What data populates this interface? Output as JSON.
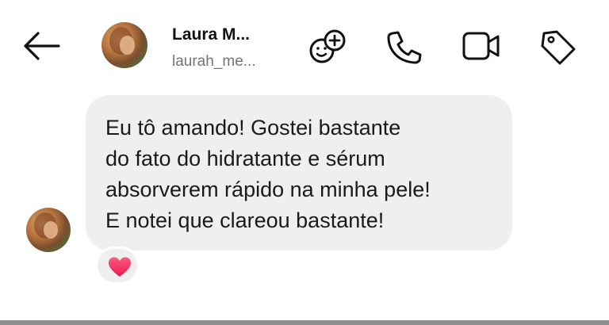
{
  "header": {
    "back_icon": "arrow-left-icon",
    "name": "Laura M...",
    "username": "laurah_me...",
    "actions": [
      {
        "icon": "sticker-add-icon",
        "label": "Sticker"
      },
      {
        "icon": "phone-icon",
        "label": "Audio call"
      },
      {
        "icon": "video-camera-icon",
        "label": "Video call"
      },
      {
        "icon": "tag-icon",
        "label": "Label"
      }
    ]
  },
  "message": {
    "lines": [
      "Eu tô amando! Gostei bastante",
      "do fato do hidratante e sérum",
      "absorverem rápido na minha pele!",
      "E notei que clareou bastante!"
    ],
    "reaction": "heart"
  },
  "colors": {
    "bubble": "#efefef",
    "username": "#737373",
    "heart": "#ff3b6b"
  }
}
